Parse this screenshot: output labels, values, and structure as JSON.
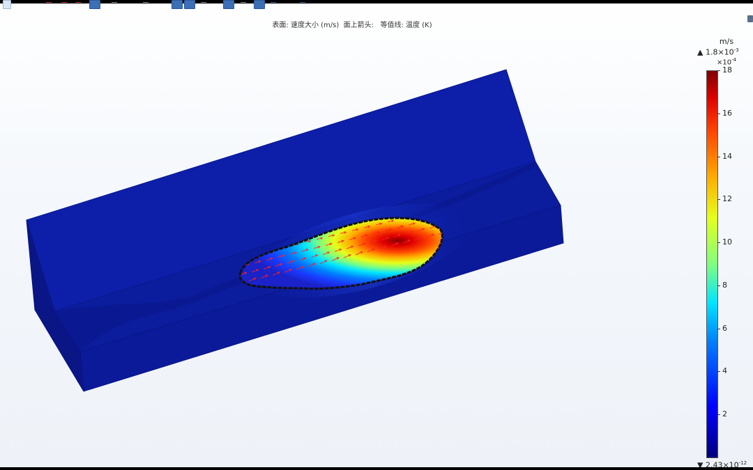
{
  "plot": {
    "title": "表面: 速度大小 (m/s)  面上箭头:   等值线: 温度 (K)"
  },
  "colorbar": {
    "unit": "m/s",
    "max_label": "▲ 1.8×10",
    "max_exp": "-3",
    "scale_label": "×10",
    "scale_exp": "-4",
    "min_label": "▼ 2.43×10",
    "min_exp": "-12",
    "ticks": [
      "18",
      "16",
      "14",
      "12",
      "10",
      "8",
      "6",
      "4",
      "2"
    ],
    "colors": [
      "#00007f",
      "#0000ff",
      "#007fff",
      "#00e5ff",
      "#7fff7f",
      "#e5ff1a",
      "#ffb000",
      "#ff4000",
      "#e00000",
      "#800000"
    ]
  },
  "model": {
    "body_color": "#0a1a9e",
    "pool_hot_color": "#e00000",
    "contour_color": "#111111",
    "arrow_color": "#ff2020"
  },
  "toolbar": {
    "icons": [
      "undo-icon",
      "select-icon",
      "select-icon",
      "select-icon",
      "select-icon",
      "select-icon",
      "pan-icon",
      "zoom-in-icon",
      "zoom-out-icon",
      "rotate-icon",
      "fit-icon",
      "view-icon",
      "view-icon",
      "transparency-icon",
      "settings-icon"
    ]
  }
}
